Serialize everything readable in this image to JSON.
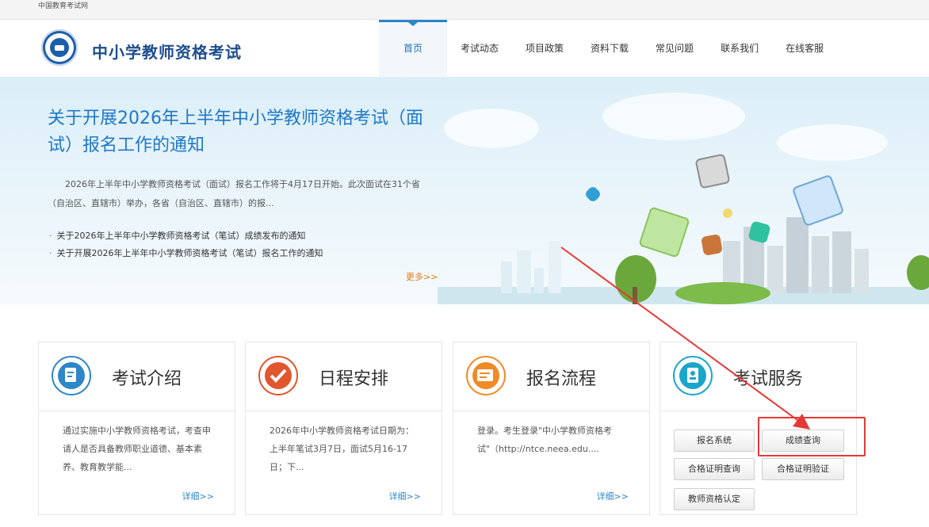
{
  "topbar": {
    "site": "中国教育考试网"
  },
  "header": {
    "logo_text": "中小学教师资格考试",
    "nav": [
      "首页",
      "考试动态",
      "项目政策",
      "资料下载",
      "常见问题",
      "联系我们",
      "在线客服"
    ],
    "active_nav": "首页"
  },
  "banner": {
    "headline": "关于开展2026年上半年中小学教师资格考试（面试）报名工作的通知",
    "intro": "2026年上半年中小学教师资格考试（面试）报名工作将于4月17日开始。此次面试在31个省（自治区、直辖市）举办，各省（自治区、直辖市）的报...",
    "news": [
      "关于2026年上半年中小学教师资格考试（笔试）成绩发布的通知",
      "关于开展2026年上半年中小学教师资格考试（笔试）报名工作的通知"
    ],
    "more": "更多>>"
  },
  "cards": [
    {
      "title": "考试介绍",
      "body": "通过实施中小学教师资格考试，考查申请人是否具备教师职业道德、基本素养、教育教学能...",
      "more": "详细>>",
      "icon": "document-pen-icon",
      "color": "#2d86c8"
    },
    {
      "title": "日程安排",
      "body": "2026年中小学教师资格考试日期为：上半年笔试3月7日，面试5月16-17日；下...",
      "more": "详细>>",
      "icon": "checkmark-icon",
      "color": "#e2562e"
    },
    {
      "title": "报名流程",
      "body": "登录。考生登录\"中小学教师资格考试\"（http://ntce.neea.edu....",
      "more": "详细>>",
      "icon": "form-edit-icon",
      "color": "#f08a24"
    },
    {
      "title": "考试服务",
      "icon": "contact-book-icon",
      "color": "#1aa6c9",
      "buttons": [
        "报名系统",
        "成绩查询",
        "合格证明查询",
        "合格证明验证",
        "教师资格认定"
      ]
    }
  ],
  "annotation": {
    "highlight_color": "#e53935",
    "highlighted_button": "成绩查询"
  }
}
